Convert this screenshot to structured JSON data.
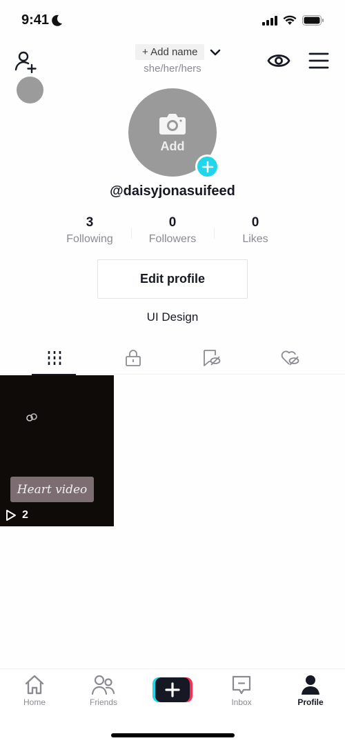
{
  "status_bar": {
    "time": "9:41"
  },
  "header": {
    "add_name_label": "+ Add name",
    "pronouns": "she/her/hers"
  },
  "profile": {
    "avatar_add_label": "Add",
    "username": "@daisyjonasuifeed",
    "stats": [
      {
        "value": "3",
        "label": "Following"
      },
      {
        "value": "0",
        "label": "Followers"
      },
      {
        "value": "0",
        "label": "Likes"
      }
    ],
    "edit_profile_label": "Edit profile",
    "bio": "UI Design"
  },
  "tabs": [
    {
      "icon": "grid-icon",
      "active": true
    },
    {
      "icon": "lock-icon",
      "active": false
    },
    {
      "icon": "bookmark-hidden-icon",
      "active": false
    },
    {
      "icon": "heart-hidden-icon",
      "active": false
    }
  ],
  "videos": [
    {
      "caption": "Heart video",
      "views": "2"
    }
  ],
  "bottom_nav": {
    "items": [
      {
        "label": "Home",
        "icon": "home-icon",
        "active": false
      },
      {
        "label": "Friends",
        "icon": "friends-icon",
        "active": false
      },
      {
        "label": "Inbox",
        "icon": "inbox-icon",
        "active": false
      },
      {
        "label": "Profile",
        "icon": "profile-icon",
        "active": true
      }
    ]
  },
  "colors": {
    "accent_cyan": "#20d5ec",
    "accent_pink": "#fe2c55",
    "text_primary": "#161823",
    "text_secondary": "#8a8b91"
  }
}
